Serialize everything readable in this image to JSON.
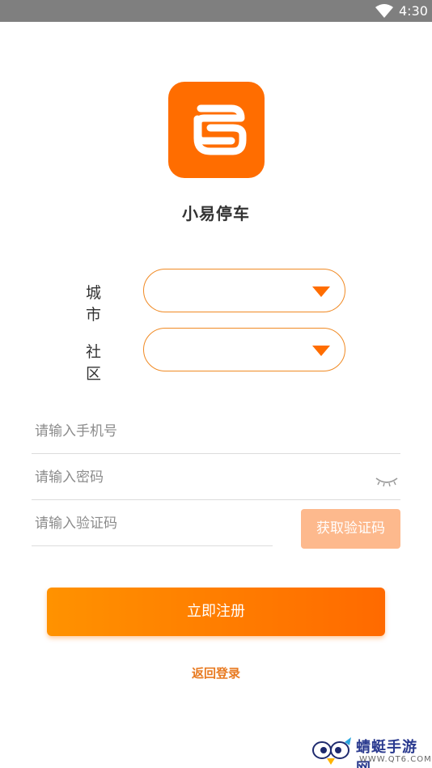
{
  "status_bar": {
    "time": "4:30",
    "wifi_icon": "wifi-icon"
  },
  "app": {
    "name": "小易停车",
    "logo_icon": "app-logo-icon",
    "brand_color": "#ff6d00"
  },
  "form": {
    "city_label": "城 市",
    "community_label": "社 区",
    "phone_placeholder": "请输入手机号",
    "password_placeholder": "请输入密码",
    "code_placeholder": "请输入验证码",
    "get_code_label": "获取验证码",
    "register_label": "立即注册",
    "back_login_label": "返回登录",
    "caret_icon": "dropdown-caret-icon",
    "eye_icon": "eye-closed-icon"
  },
  "watermark": {
    "text": "蜻蜓手游网",
    "url": "WWW.QT6.COM"
  }
}
